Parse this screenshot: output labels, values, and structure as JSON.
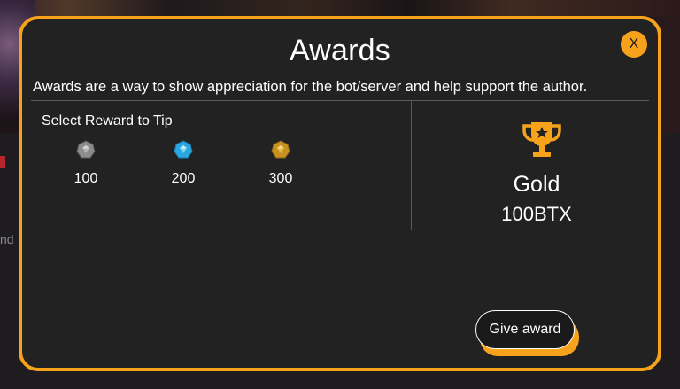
{
  "background": {
    "side_text": "nd"
  },
  "modal": {
    "title": "Awards",
    "close_label": "X",
    "subtitle": "Awards are a way to show appreciation for the bot/server and help support the author.",
    "select_label": "Select Reward to Tip",
    "rewards": [
      {
        "amount": "100",
        "gem_icon": "silver-gem-icon",
        "color": "#8c8c8c"
      },
      {
        "amount": "200",
        "gem_icon": "blue-gem-icon",
        "color": "#2aa6e0"
      },
      {
        "amount": "300",
        "gem_icon": "gold-gem-icon",
        "color": "#c79222"
      }
    ],
    "selected_award": {
      "icon": "trophy-icon",
      "name": "Gold",
      "cost": "100BTX"
    },
    "give_button_label": "Give award",
    "accent_color": "#f7a21b"
  }
}
